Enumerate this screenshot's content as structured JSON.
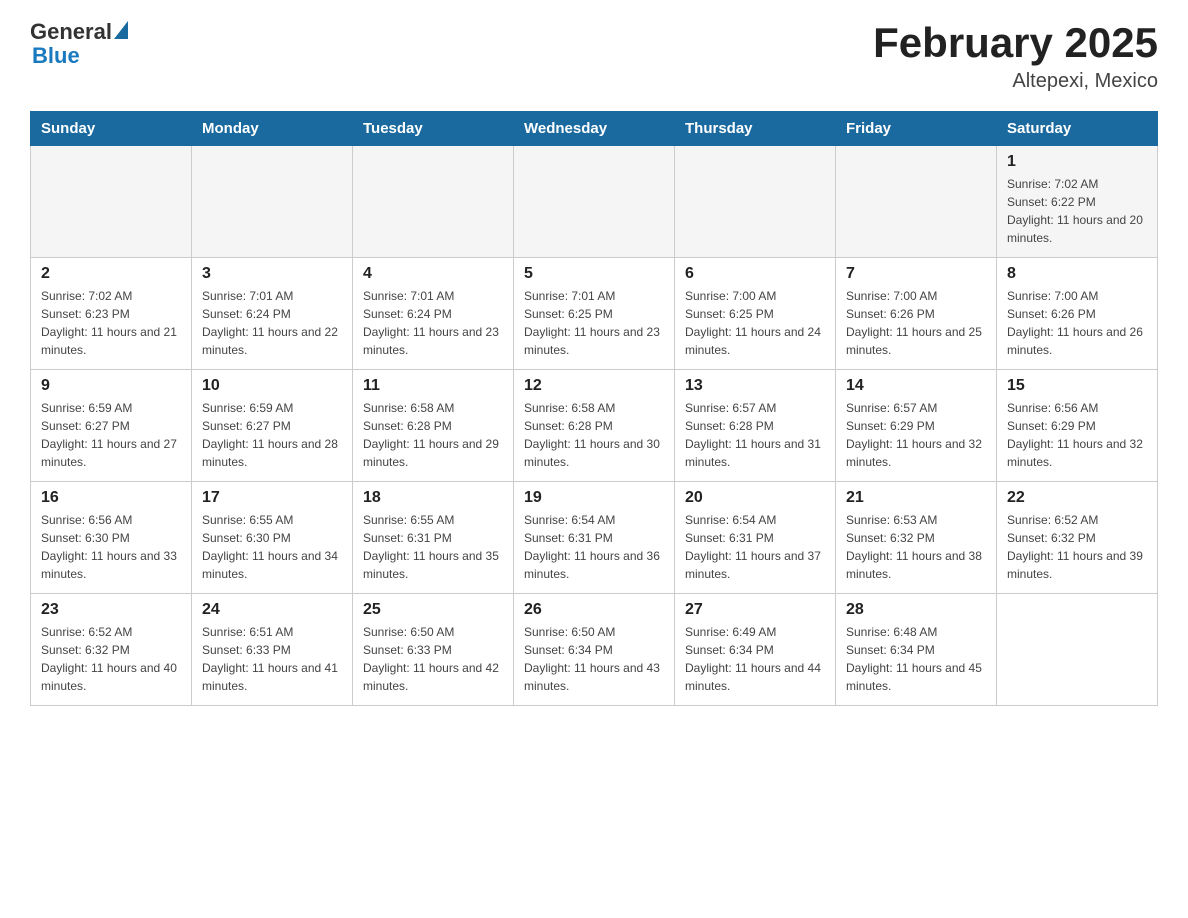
{
  "header": {
    "logo_general": "General",
    "logo_blue": "Blue",
    "title": "February 2025",
    "subtitle": "Altepexi, Mexico"
  },
  "calendar": {
    "weekdays": [
      "Sunday",
      "Monday",
      "Tuesday",
      "Wednesday",
      "Thursday",
      "Friday",
      "Saturday"
    ],
    "weeks": [
      [
        {
          "day": "",
          "info": ""
        },
        {
          "day": "",
          "info": ""
        },
        {
          "day": "",
          "info": ""
        },
        {
          "day": "",
          "info": ""
        },
        {
          "day": "",
          "info": ""
        },
        {
          "day": "",
          "info": ""
        },
        {
          "day": "1",
          "info": "Sunrise: 7:02 AM\nSunset: 6:22 PM\nDaylight: 11 hours and 20 minutes."
        }
      ],
      [
        {
          "day": "2",
          "info": "Sunrise: 7:02 AM\nSunset: 6:23 PM\nDaylight: 11 hours and 21 minutes."
        },
        {
          "day": "3",
          "info": "Sunrise: 7:01 AM\nSunset: 6:24 PM\nDaylight: 11 hours and 22 minutes."
        },
        {
          "day": "4",
          "info": "Sunrise: 7:01 AM\nSunset: 6:24 PM\nDaylight: 11 hours and 23 minutes."
        },
        {
          "day": "5",
          "info": "Sunrise: 7:01 AM\nSunset: 6:25 PM\nDaylight: 11 hours and 23 minutes."
        },
        {
          "day": "6",
          "info": "Sunrise: 7:00 AM\nSunset: 6:25 PM\nDaylight: 11 hours and 24 minutes."
        },
        {
          "day": "7",
          "info": "Sunrise: 7:00 AM\nSunset: 6:26 PM\nDaylight: 11 hours and 25 minutes."
        },
        {
          "day": "8",
          "info": "Sunrise: 7:00 AM\nSunset: 6:26 PM\nDaylight: 11 hours and 26 minutes."
        }
      ],
      [
        {
          "day": "9",
          "info": "Sunrise: 6:59 AM\nSunset: 6:27 PM\nDaylight: 11 hours and 27 minutes."
        },
        {
          "day": "10",
          "info": "Sunrise: 6:59 AM\nSunset: 6:27 PM\nDaylight: 11 hours and 28 minutes."
        },
        {
          "day": "11",
          "info": "Sunrise: 6:58 AM\nSunset: 6:28 PM\nDaylight: 11 hours and 29 minutes."
        },
        {
          "day": "12",
          "info": "Sunrise: 6:58 AM\nSunset: 6:28 PM\nDaylight: 11 hours and 30 minutes."
        },
        {
          "day": "13",
          "info": "Sunrise: 6:57 AM\nSunset: 6:28 PM\nDaylight: 11 hours and 31 minutes."
        },
        {
          "day": "14",
          "info": "Sunrise: 6:57 AM\nSunset: 6:29 PM\nDaylight: 11 hours and 32 minutes."
        },
        {
          "day": "15",
          "info": "Sunrise: 6:56 AM\nSunset: 6:29 PM\nDaylight: 11 hours and 32 minutes."
        }
      ],
      [
        {
          "day": "16",
          "info": "Sunrise: 6:56 AM\nSunset: 6:30 PM\nDaylight: 11 hours and 33 minutes."
        },
        {
          "day": "17",
          "info": "Sunrise: 6:55 AM\nSunset: 6:30 PM\nDaylight: 11 hours and 34 minutes."
        },
        {
          "day": "18",
          "info": "Sunrise: 6:55 AM\nSunset: 6:31 PM\nDaylight: 11 hours and 35 minutes."
        },
        {
          "day": "19",
          "info": "Sunrise: 6:54 AM\nSunset: 6:31 PM\nDaylight: 11 hours and 36 minutes."
        },
        {
          "day": "20",
          "info": "Sunrise: 6:54 AM\nSunset: 6:31 PM\nDaylight: 11 hours and 37 minutes."
        },
        {
          "day": "21",
          "info": "Sunrise: 6:53 AM\nSunset: 6:32 PM\nDaylight: 11 hours and 38 minutes."
        },
        {
          "day": "22",
          "info": "Sunrise: 6:52 AM\nSunset: 6:32 PM\nDaylight: 11 hours and 39 minutes."
        }
      ],
      [
        {
          "day": "23",
          "info": "Sunrise: 6:52 AM\nSunset: 6:32 PM\nDaylight: 11 hours and 40 minutes."
        },
        {
          "day": "24",
          "info": "Sunrise: 6:51 AM\nSunset: 6:33 PM\nDaylight: 11 hours and 41 minutes."
        },
        {
          "day": "25",
          "info": "Sunrise: 6:50 AM\nSunset: 6:33 PM\nDaylight: 11 hours and 42 minutes."
        },
        {
          "day": "26",
          "info": "Sunrise: 6:50 AM\nSunset: 6:34 PM\nDaylight: 11 hours and 43 minutes."
        },
        {
          "day": "27",
          "info": "Sunrise: 6:49 AM\nSunset: 6:34 PM\nDaylight: 11 hours and 44 minutes."
        },
        {
          "day": "28",
          "info": "Sunrise: 6:48 AM\nSunset: 6:34 PM\nDaylight: 11 hours and 45 minutes."
        },
        {
          "day": "",
          "info": ""
        }
      ]
    ]
  }
}
